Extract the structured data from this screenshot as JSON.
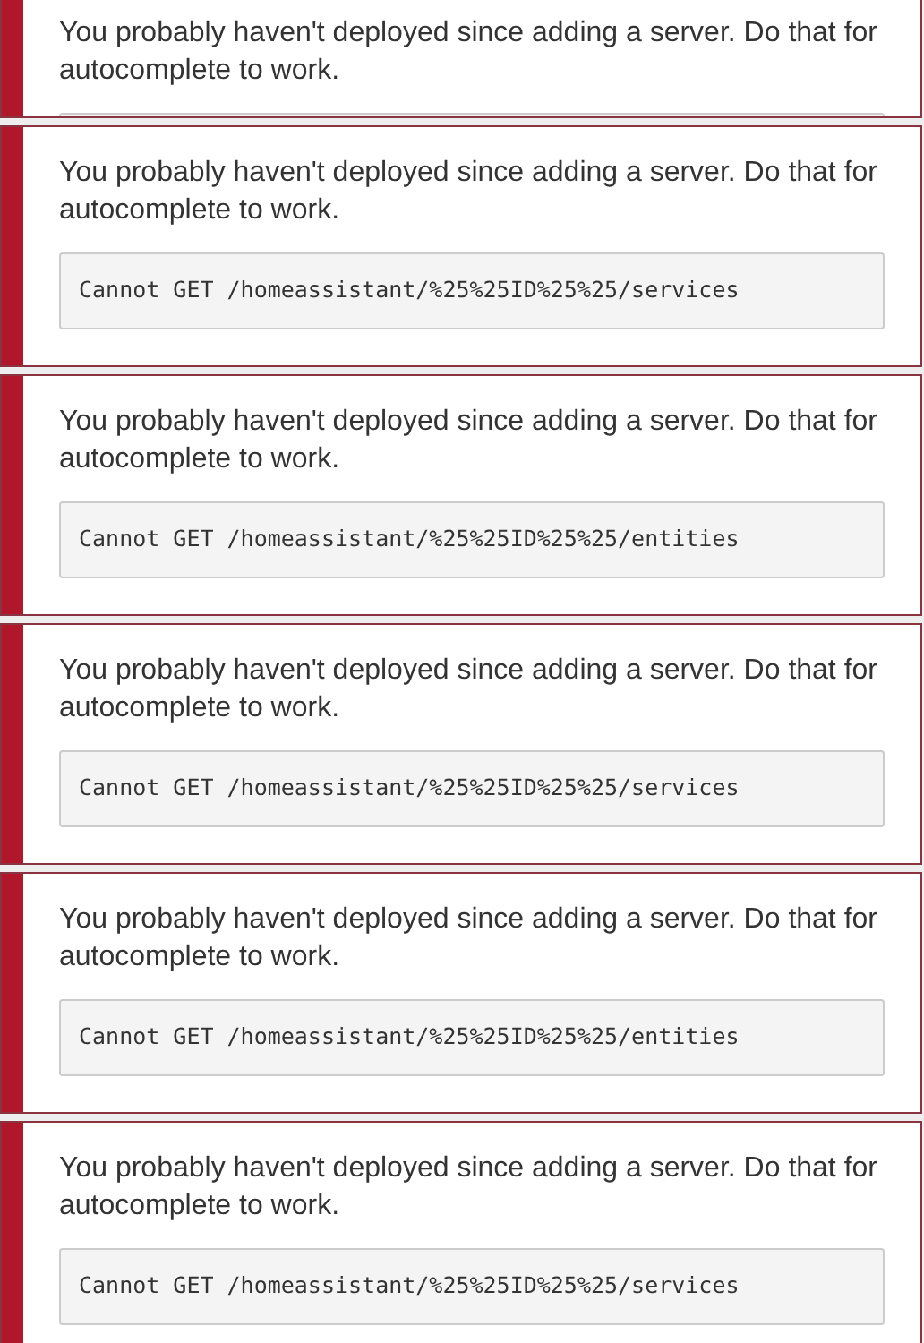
{
  "notifications": [
    {
      "message": "You probably haven't deployed since adding a server. Do that for autocomplete to work.",
      "covered": true
    },
    {
      "message": "You probably haven't deployed since adding a server. Do that for autocomplete to work.",
      "code": "Cannot GET /homeassistant/%25%25ID%25%25/services"
    },
    {
      "message": "You probably haven't deployed since adding a server. Do that for autocomplete to work.",
      "code": "Cannot GET /homeassistant/%25%25ID%25%25/entities"
    },
    {
      "message": "You probably haven't deployed since adding a server. Do that for autocomplete to work.",
      "code": "Cannot GET /homeassistant/%25%25ID%25%25/services"
    },
    {
      "message": "You probably haven't deployed since adding a server. Do that for autocomplete to work.",
      "code": "Cannot GET /homeassistant/%25%25ID%25%25/entities"
    },
    {
      "message": "You probably haven't deployed since adding a server. Do that for autocomplete to work.",
      "code": "Cannot GET /homeassistant/%25%25ID%25%25/services"
    }
  ]
}
